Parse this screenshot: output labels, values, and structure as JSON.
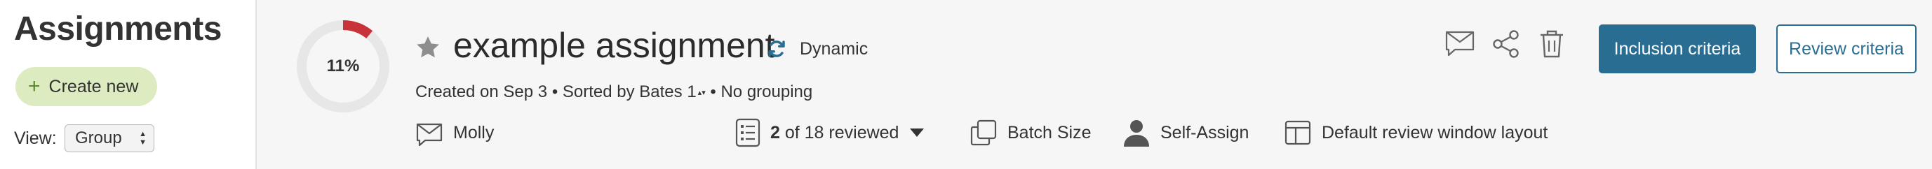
{
  "sidebar": {
    "title": "Assignments",
    "create_label": "Create new",
    "view_label": "View:",
    "view_value": "Group"
  },
  "assignment": {
    "progress_percent_label": "11%",
    "progress_fraction": 0.11,
    "title": "example assignment",
    "mode_label": "Dynamic",
    "meta": {
      "created": "Created on Sep 3",
      "sorted": "Sorted by Bates 1",
      "grouping": "No grouping",
      "separator": "•"
    },
    "toolbar": {
      "assignee": "Molly",
      "reviewed_bold": "2",
      "reviewed_rest": "of 18 reviewed",
      "batch_size": "Batch Size",
      "self_assign": "Self-Assign",
      "layout": "Default review window layout"
    },
    "buttons": {
      "inclusion": "Inclusion criteria",
      "review": "Review criteria"
    }
  },
  "colors": {
    "accent": "#2a6d93",
    "progress_arc": "#c8333a",
    "create_bg": "#dcebc0"
  },
  "icons": [
    "plus-icon",
    "star-icon",
    "sync-icon",
    "mail-icon",
    "share-icon",
    "trash-icon",
    "list-icon",
    "dropdown-caret-icon",
    "copy-icon",
    "person-icon",
    "layout-icon"
  ]
}
